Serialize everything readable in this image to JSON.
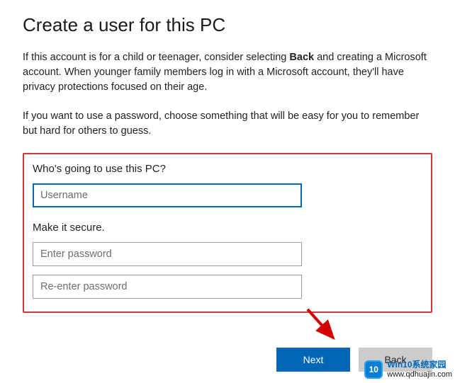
{
  "title": "Create a user for this PC",
  "intro": {
    "part1_prefix": "If this account is for a child or teenager, consider selecting ",
    "part1_bold": "Back",
    "part1_suffix": " and creating a Microsoft account. When younger family members log in with a Microsoft account, they'll have privacy protections focused on their age.",
    "part2": "If you want to use a password, choose something that will be easy for you to remember but hard for others to guess."
  },
  "form": {
    "question": "Who's going to use this PC?",
    "username_placeholder": "Username",
    "username_value": "",
    "secure_label": "Make it secure.",
    "password_placeholder": "Enter password",
    "confirm_placeholder": "Re-enter password"
  },
  "buttons": {
    "next": "Next",
    "back": "Back"
  },
  "watermark": {
    "logo": "10",
    "title": "Win10系统家园",
    "url": "www.qdhuajin.com"
  }
}
